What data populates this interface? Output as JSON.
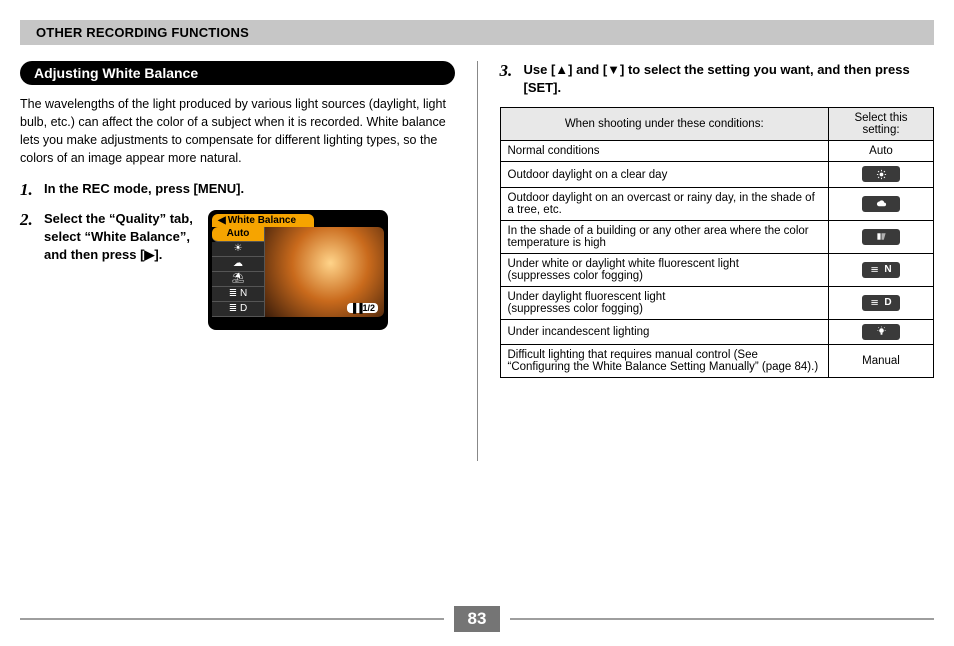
{
  "section_header": "OTHER RECORDING FUNCTIONS",
  "heading": "Adjusting White Balance",
  "intro": "The wavelengths of the light produced by various light sources (daylight, light bulb, etc.) can affect the color of a subject when it is recorded. White balance lets you make adjustments to compensate for different lighting types, so the colors of an image appear more natural.",
  "steps": {
    "s1": {
      "num": "1.",
      "text": "In the REC mode, press [MENU]."
    },
    "s2": {
      "num": "2.",
      "text": "Select the “Quality” tab, select “White Balance”, and then press [▶]."
    },
    "s3": {
      "num": "3.",
      "text": "Use [▲] and [▼] to select the setting you want, and then press [SET]."
    }
  },
  "camera_menu": {
    "tab": "White Balance",
    "tab_arrow": "◀",
    "items": [
      "Auto",
      "☀",
      "☁",
      "⛱",
      "≣ N",
      "≣ D"
    ],
    "badge": "1/2",
    "battery": "▐▐"
  },
  "table": {
    "head_cond": "When shooting under these conditions:",
    "head_set": "Select this setting:",
    "rows": [
      {
        "cond": "Normal conditions",
        "label": "Auto",
        "icon": "none"
      },
      {
        "cond": "Outdoor daylight on a clear day",
        "label": "",
        "icon": "sun"
      },
      {
        "cond": "Outdoor daylight on an overcast or rainy day, in the shade of a tree, etc.",
        "label": "",
        "icon": "cloud"
      },
      {
        "cond": "In the shade of a building or any other area where the color temperature is high",
        "label": "",
        "icon": "shade"
      },
      {
        "cond": "Under white or daylight white fluorescent light\n(suppresses color fogging)",
        "label": "N",
        "icon": "fluoro"
      },
      {
        "cond": "Under daylight fluorescent light\n(suppresses color fogging)",
        "label": "D",
        "icon": "fluoro"
      },
      {
        "cond": "Under incandescent lighting",
        "label": "",
        "icon": "bulb"
      },
      {
        "cond": "Difficult lighting that requires manual control (See “Configuring the White Balance Setting Manually” (page 84).)",
        "label": "Manual",
        "icon": "none"
      }
    ]
  },
  "page_number": "83"
}
